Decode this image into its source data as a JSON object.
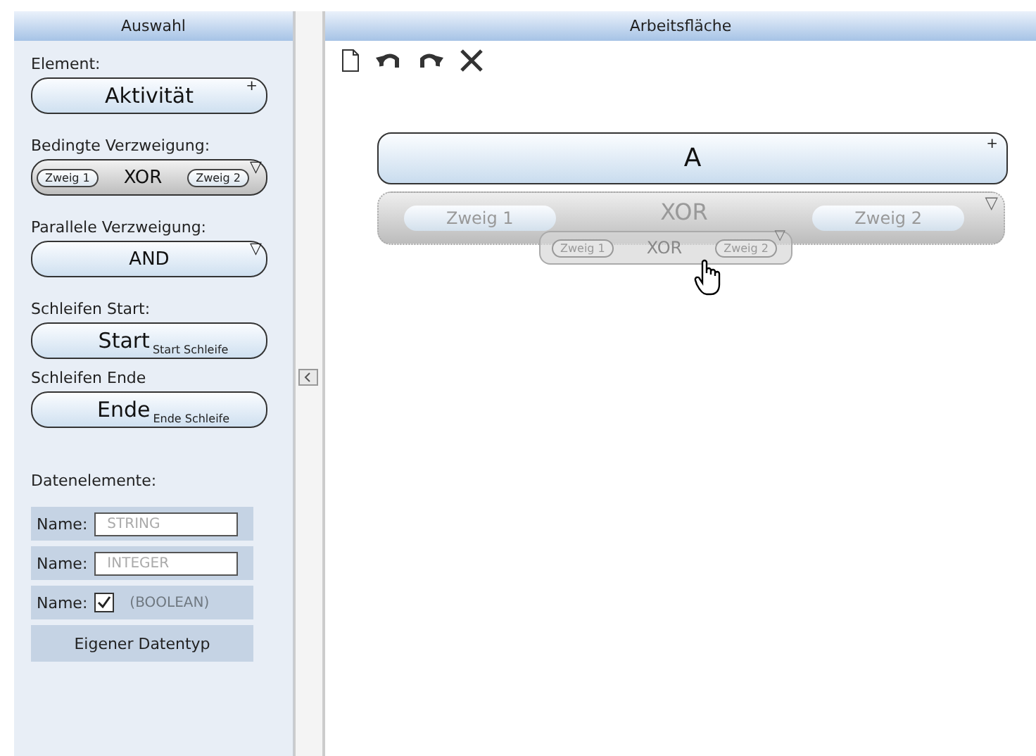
{
  "left_panel": {
    "title": "Auswahl"
  },
  "palette": [
    {
      "kind": "activity",
      "heading": "Element:",
      "label": "Aktivität",
      "marker": "+"
    },
    {
      "kind": "xor",
      "heading": "Bedingte Verzweigung:",
      "label": "XOR",
      "branches": [
        "Zweig 1",
        "Zweig 2"
      ],
      "marker": "▽"
    },
    {
      "kind": "and",
      "heading": "Parallele Verzweigung:",
      "label": "AND",
      "marker": "▽"
    },
    {
      "kind": "loop",
      "heading": "Schleifen Start:",
      "label": "Start",
      "sub": "Start Schleife"
    },
    {
      "kind": "loop",
      "heading": "Schleifen Ende",
      "label": "Ende",
      "sub": "Ende Schleife"
    }
  ],
  "data_elements": {
    "heading": "Datenelemente:",
    "rows": [
      {
        "kind": "text",
        "label": "Name:",
        "placeholder": "STRING"
      },
      {
        "kind": "text",
        "label": "Name:",
        "placeholder": "INTEGER"
      },
      {
        "kind": "checkbox",
        "label": "Name:",
        "checked": true,
        "hint": "(BOOLEAN)"
      }
    ],
    "button": "Eigener Datentyp"
  },
  "right_panel": {
    "title": "Arbeitsfläche"
  },
  "canvas": {
    "activity": {
      "label": "A",
      "marker": "+"
    },
    "xor": {
      "label": "XOR",
      "branches": [
        "Zweig 1",
        "Zweig 2"
      ],
      "marker": "▽"
    },
    "dragged": {
      "label": "XOR",
      "branches": [
        "Zweig 1",
        "Zweig 2"
      ],
      "marker": "▽"
    }
  }
}
